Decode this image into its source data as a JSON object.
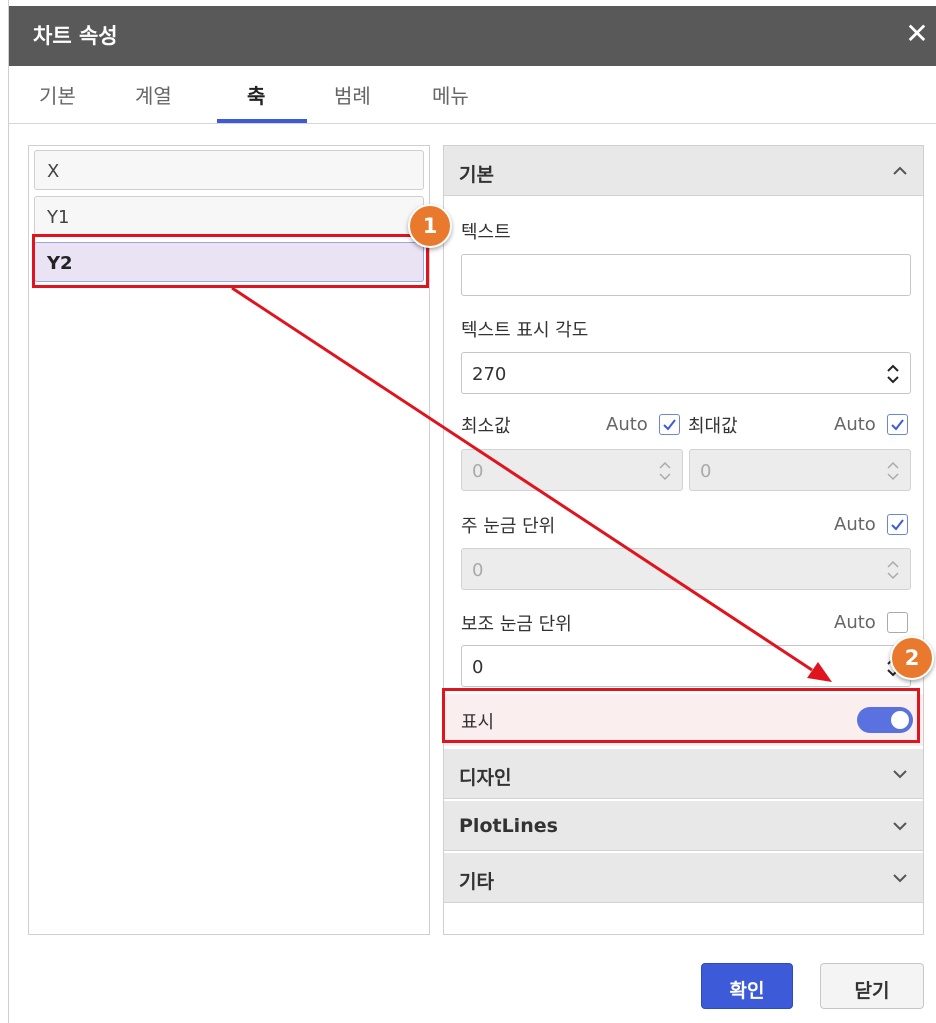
{
  "dialog": {
    "title": "차트 속성",
    "close_label": "✕"
  },
  "tabs": [
    {
      "label": "기본"
    },
    {
      "label": "계열"
    },
    {
      "label": "축",
      "active": true
    },
    {
      "label": "범례"
    },
    {
      "label": "메뉴"
    }
  ],
  "axes": [
    {
      "label": "X"
    },
    {
      "label": "Y1"
    },
    {
      "label": "Y2",
      "selected": true
    }
  ],
  "sections": {
    "basic": {
      "title": "기본",
      "text_label": "텍스트",
      "text_value": "",
      "angle_label": "텍스트 표시 각도",
      "angle_value": "270",
      "min_label": "최소값",
      "min_auto": "Auto",
      "min_auto_checked": true,
      "min_value": "0",
      "max_label": "최대값",
      "max_auto": "Auto",
      "max_auto_checked": true,
      "max_value": "0",
      "major_label": "주 눈금 단위",
      "major_auto": "Auto",
      "major_auto_checked": true,
      "major_value": "0",
      "minor_label": "보조 눈금 단위",
      "minor_auto": "Auto",
      "minor_auto_checked": false,
      "minor_value": "0",
      "show_label": "표시",
      "show_on": true
    },
    "design": {
      "title": "디자인"
    },
    "plotlines": {
      "title": "PlotLines"
    },
    "etc": {
      "title": "기타"
    }
  },
  "buttons": {
    "ok": "확인",
    "close": "닫기"
  },
  "annotations": {
    "step1": "1",
    "step2": "2",
    "highlight_color": "#e0141e",
    "badge_color": "#e8792d"
  },
  "colors": {
    "accent": "#3d5bd9",
    "titlebar": "#595959",
    "toggle_on": "#5a72e0"
  }
}
